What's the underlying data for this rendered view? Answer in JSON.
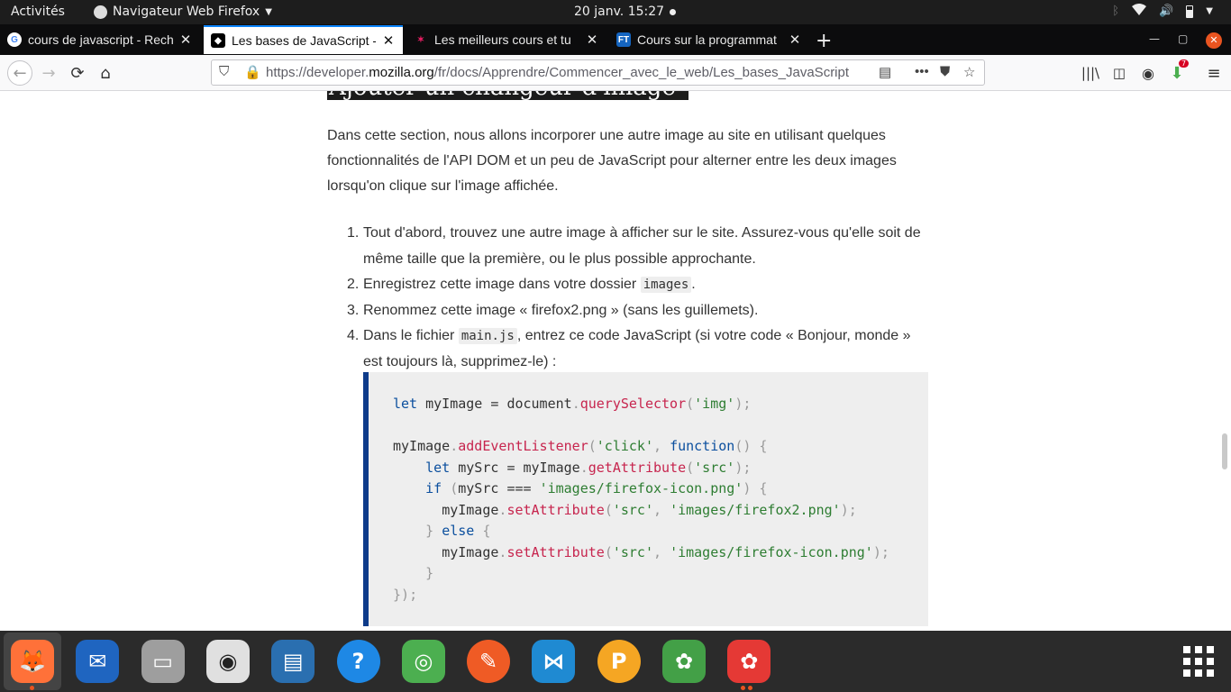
{
  "topbar": {
    "activities": "Activités",
    "app_menu": "Navigateur Web Firefox",
    "clock": "20 janv.  15:27"
  },
  "tabs": [
    {
      "title": "cours de javascript - Rech",
      "favicon": "google-icon",
      "color": "#4285f4"
    },
    {
      "title": "Les bases de JavaScript - A",
      "favicon": "mdn-icon",
      "color": "#000000"
    },
    {
      "title": "Les meilleurs cours et tu",
      "favicon": "developpez-icon",
      "color": "#c2185b"
    },
    {
      "title": "Cours sur la programmat",
      "favicon": "ft-icon",
      "color": "#1565c0"
    }
  ],
  "navbar": {
    "url_prefix": "https://developer.",
    "url_domain": "mozilla.org",
    "url_path": "/fr/docs/Apprendre/Commencer_avec_le_web/Les_bases_JavaScript",
    "download_badge": "7"
  },
  "content": {
    "heading_fragment": "Ajouter un changeur d'image",
    "intro": "Dans cette section, nous allons incorporer une autre image au site en utilisant quelques fonctionnalités de l'API DOM et un peu de JavaScript pour alterner entre les deux images lorsqu'on clique sur l'image affichée.",
    "steps": [
      {
        "num": "1.",
        "text": "Tout d'abord, trouvez une autre image à afficher sur le site. Assurez-vous qu'elle soit de même taille que la première, ou le plus possible approchante."
      },
      {
        "num": "2.",
        "pre": "Enregistrez cette image dans votre dossier ",
        "code": "images",
        "post": "."
      },
      {
        "num": "3.",
        "text": "Renommez cette image « firefox2.png » (sans les guillemets)."
      },
      {
        "num": "4.",
        "pre": "Dans le fichier ",
        "code": "main.js",
        "post": ", entrez ce code JavaScript (si votre code « Bonjour, monde » est toujours là, supprimez-le) :"
      }
    ],
    "code_lines": [
      "let myImage = document.querySelector('img');",
      "",
      "myImage.addEventListener('click', function() {",
      "    let mySrc = myImage.getAttribute('src');",
      "    if (mySrc === 'images/firefox-icon.png') {",
      "      myImage.setAttribute('src', 'images/firefox2.png');",
      "    } else {",
      "      myImage.setAttribute('src', 'images/firefox-icon.png');",
      "    }",
      "});"
    ]
  },
  "dock": [
    {
      "name": "firefox-icon",
      "color": "#ff7139"
    },
    {
      "name": "thunderbird-icon",
      "color": "#1f65c0"
    },
    {
      "name": "files-icon",
      "color": "#9e9e9e"
    },
    {
      "name": "rhythmbox-icon",
      "color": "#e0e0e0"
    },
    {
      "name": "libreoffice-writer-icon",
      "color": "#2a6fb0"
    },
    {
      "name": "help-icon",
      "color": "#1e88e5"
    },
    {
      "name": "chrome-icon",
      "color": "#4caf50"
    },
    {
      "name": "postman-icon",
      "color": "#ef5b25"
    },
    {
      "name": "vscode-icon",
      "color": "#1f8ad2"
    },
    {
      "name": "plex-icon",
      "color": "#f5a623"
    },
    {
      "name": "solitaire-icon",
      "color": "#43a047"
    },
    {
      "name": "solitaire-icon-2",
      "color": "#e53935"
    }
  ]
}
